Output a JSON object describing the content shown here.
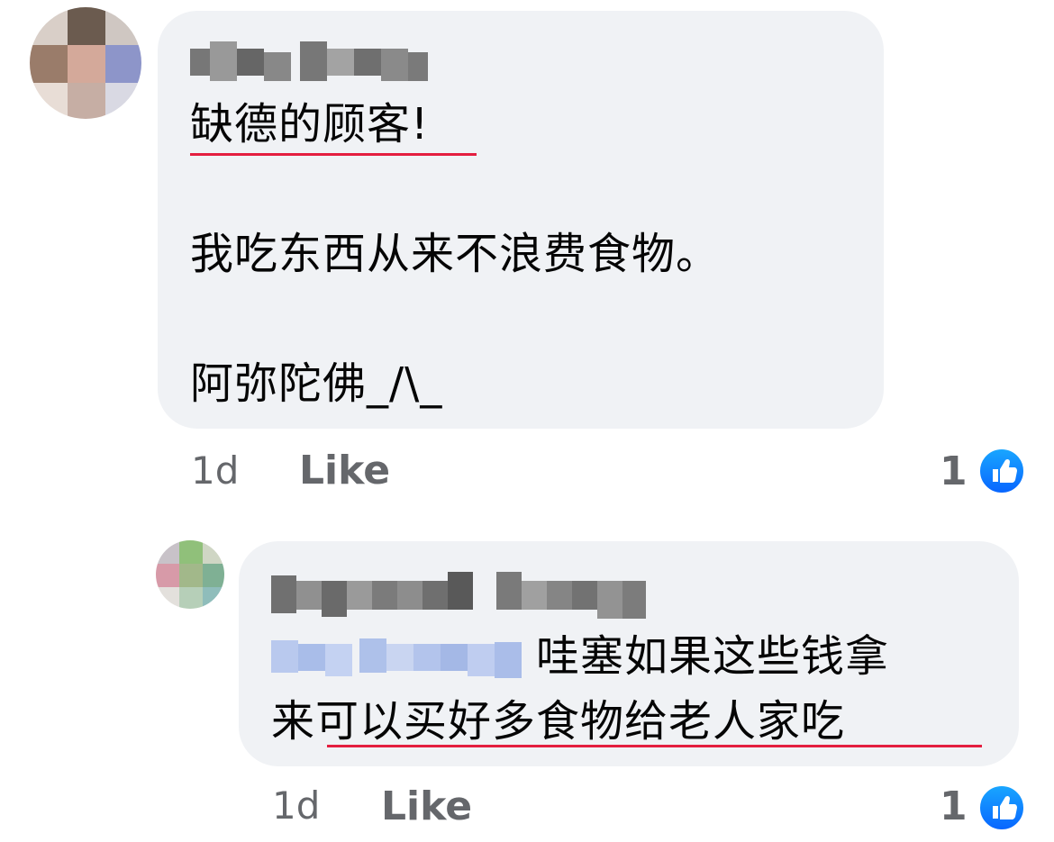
{
  "comments": [
    {
      "author": "May Wong",
      "lines": [
        "缺德的顾客!",
        "我吃东西从来不浪费食物。",
        "阿弥陀佛_/\\_"
      ],
      "time": "1d",
      "like_label": "Like",
      "reaction_count": "1",
      "reaction_icon": "thumbs-up-icon"
    },
    {
      "author": "Raymond Chong",
      "mention": "May Wong",
      "line1_text": "哇塞如果这些钱拿",
      "line2": "来可以买好多食物给老人家吃",
      "time": "1d",
      "like_label": "Like",
      "reaction_count": "1",
      "reaction_icon": "thumbs-up-icon"
    }
  ],
  "colors": {
    "bubble": "#f0f2f5",
    "underline": "#e41e3f",
    "meta": "#65676b",
    "like_blue": "#0866ff"
  }
}
